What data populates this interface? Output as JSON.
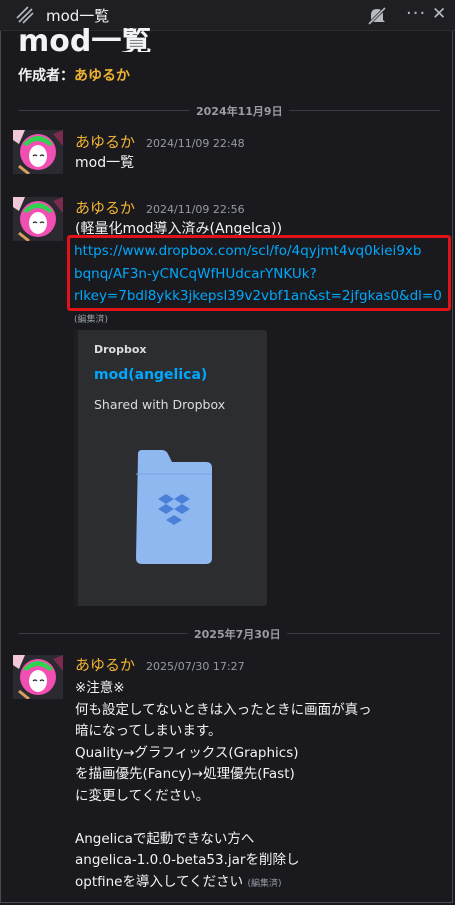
{
  "topbar": {
    "title": "mod一覧"
  },
  "header": {
    "big_title": "mod一覧",
    "creator_label": "作成者：",
    "creator_name": "あゆるか"
  },
  "dividers": [
    "2024年11月9日",
    "2025年7月30日"
  ],
  "messages": [
    {
      "author": "あゆるか",
      "time": "2024/11/09 22:48",
      "text": "mod一覧"
    },
    {
      "author": "あゆるか",
      "time": "2024/11/09 22:56",
      "text": "(軽量化mod導入済み(Angelca))",
      "link_lines": [
        "https://www.dropbox.com/scl/fo/4qyjmt4vq0kiei9xb",
        "bqnq/AF3n-yCNCqWfHUdcarYNKUk?",
        "rlkey=7bdl8ykk3jkepsl39v2vbf1an&st=2jfgkas0&dl=0"
      ],
      "edited": "(編集済)",
      "embed": {
        "provider": "Dropbox",
        "title": "mod(angelica)",
        "description": "Shared with Dropbox"
      }
    },
    {
      "author": "あゆるか",
      "time": "2025/07/30 17:27",
      "lines": [
        "※注意※",
        "何も設定してないときは入ったときに画面が真っ",
        "暗になってしまいます。",
        "Quality→グラフィックス(Graphics)",
        "を描画優先(Fancy)→処理優先(Fast)",
        "に変更してください。",
        "",
        "Angelicaで起動できない方へ",
        "angelica-1.0.0-beta53.jarを削除し",
        "optfineを導入してください"
      ],
      "edited": "(編集済)"
    }
  ],
  "colors": {
    "accent_name": "#f0b232",
    "link": "#00a8fc",
    "highlight_box": "#e0131a"
  }
}
